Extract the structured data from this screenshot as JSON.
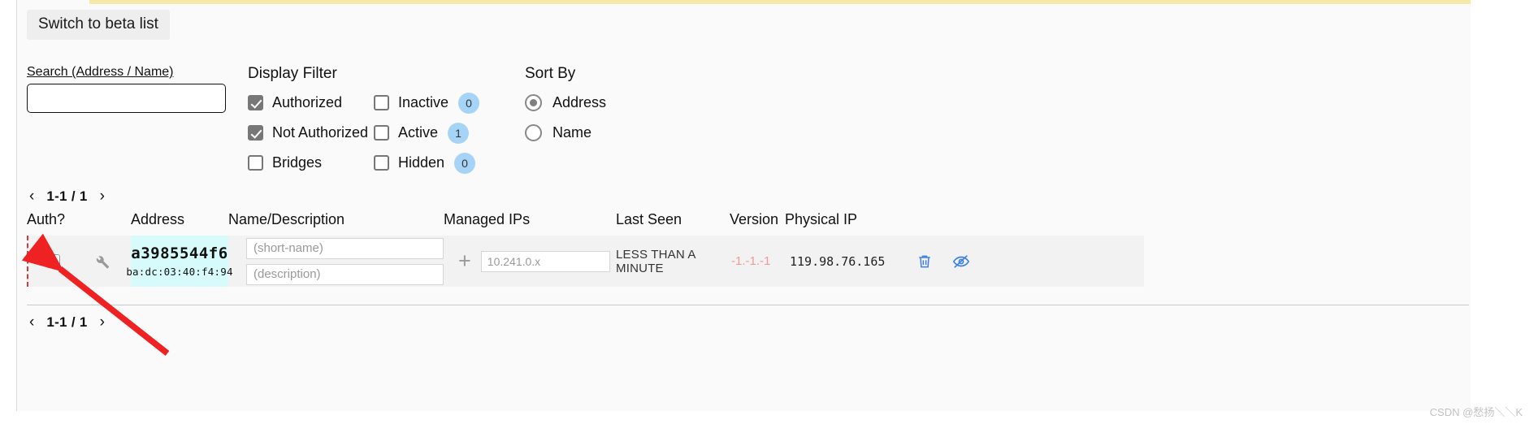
{
  "toolbar": {
    "beta_button": "Switch to beta list"
  },
  "search": {
    "label": "Search (Address / Name)",
    "value": "",
    "placeholder": ""
  },
  "display_filter": {
    "title": "Display Filter",
    "items": [
      {
        "label": "Authorized",
        "checked": true,
        "badge": null
      },
      {
        "label": "Not Authorized",
        "checked": true,
        "badge": null
      },
      {
        "label": "Bridges",
        "checked": false,
        "badge": null
      },
      {
        "label": "Inactive",
        "checked": false,
        "badge": "0"
      },
      {
        "label": "Active",
        "checked": false,
        "badge": "1"
      },
      {
        "label": "Hidden",
        "checked": false,
        "badge": "0"
      }
    ]
  },
  "sort_by": {
    "title": "Sort By",
    "options": [
      {
        "label": "Address",
        "selected": true
      },
      {
        "label": "Name",
        "selected": false
      }
    ]
  },
  "pagination": {
    "range": "1-1 / 1",
    "prev": "‹",
    "next": "›"
  },
  "table": {
    "columns": [
      "Auth?",
      "Address",
      "Name/Description",
      "Managed IPs",
      "Last Seen",
      "Version",
      "Physical IP"
    ],
    "rows": [
      {
        "auth_checked": false,
        "address_id": "a3985544f6",
        "address_mac": "ba:dc:03:40:f4:94",
        "name_placeholder": "(short-name)",
        "name_value": "",
        "description_placeholder": "(description)",
        "description_value": "",
        "managed_ip_placeholder": "10.241.0.x",
        "managed_ip_value": "",
        "last_seen": "LESS THAN A MINUTE",
        "version": "-1.-1.-1",
        "physical_ip": "119.98.76.165"
      }
    ]
  },
  "colors": {
    "badge": "#a6d4f7",
    "address_cell": "#d7fbfb",
    "version_text": "#f09a9a",
    "action_icon": "#3d7fe8",
    "annotation_arrow": "#ee2222",
    "top_strip": "#f6e8a8"
  },
  "watermark": "CSDN @愁扬＼＼K"
}
